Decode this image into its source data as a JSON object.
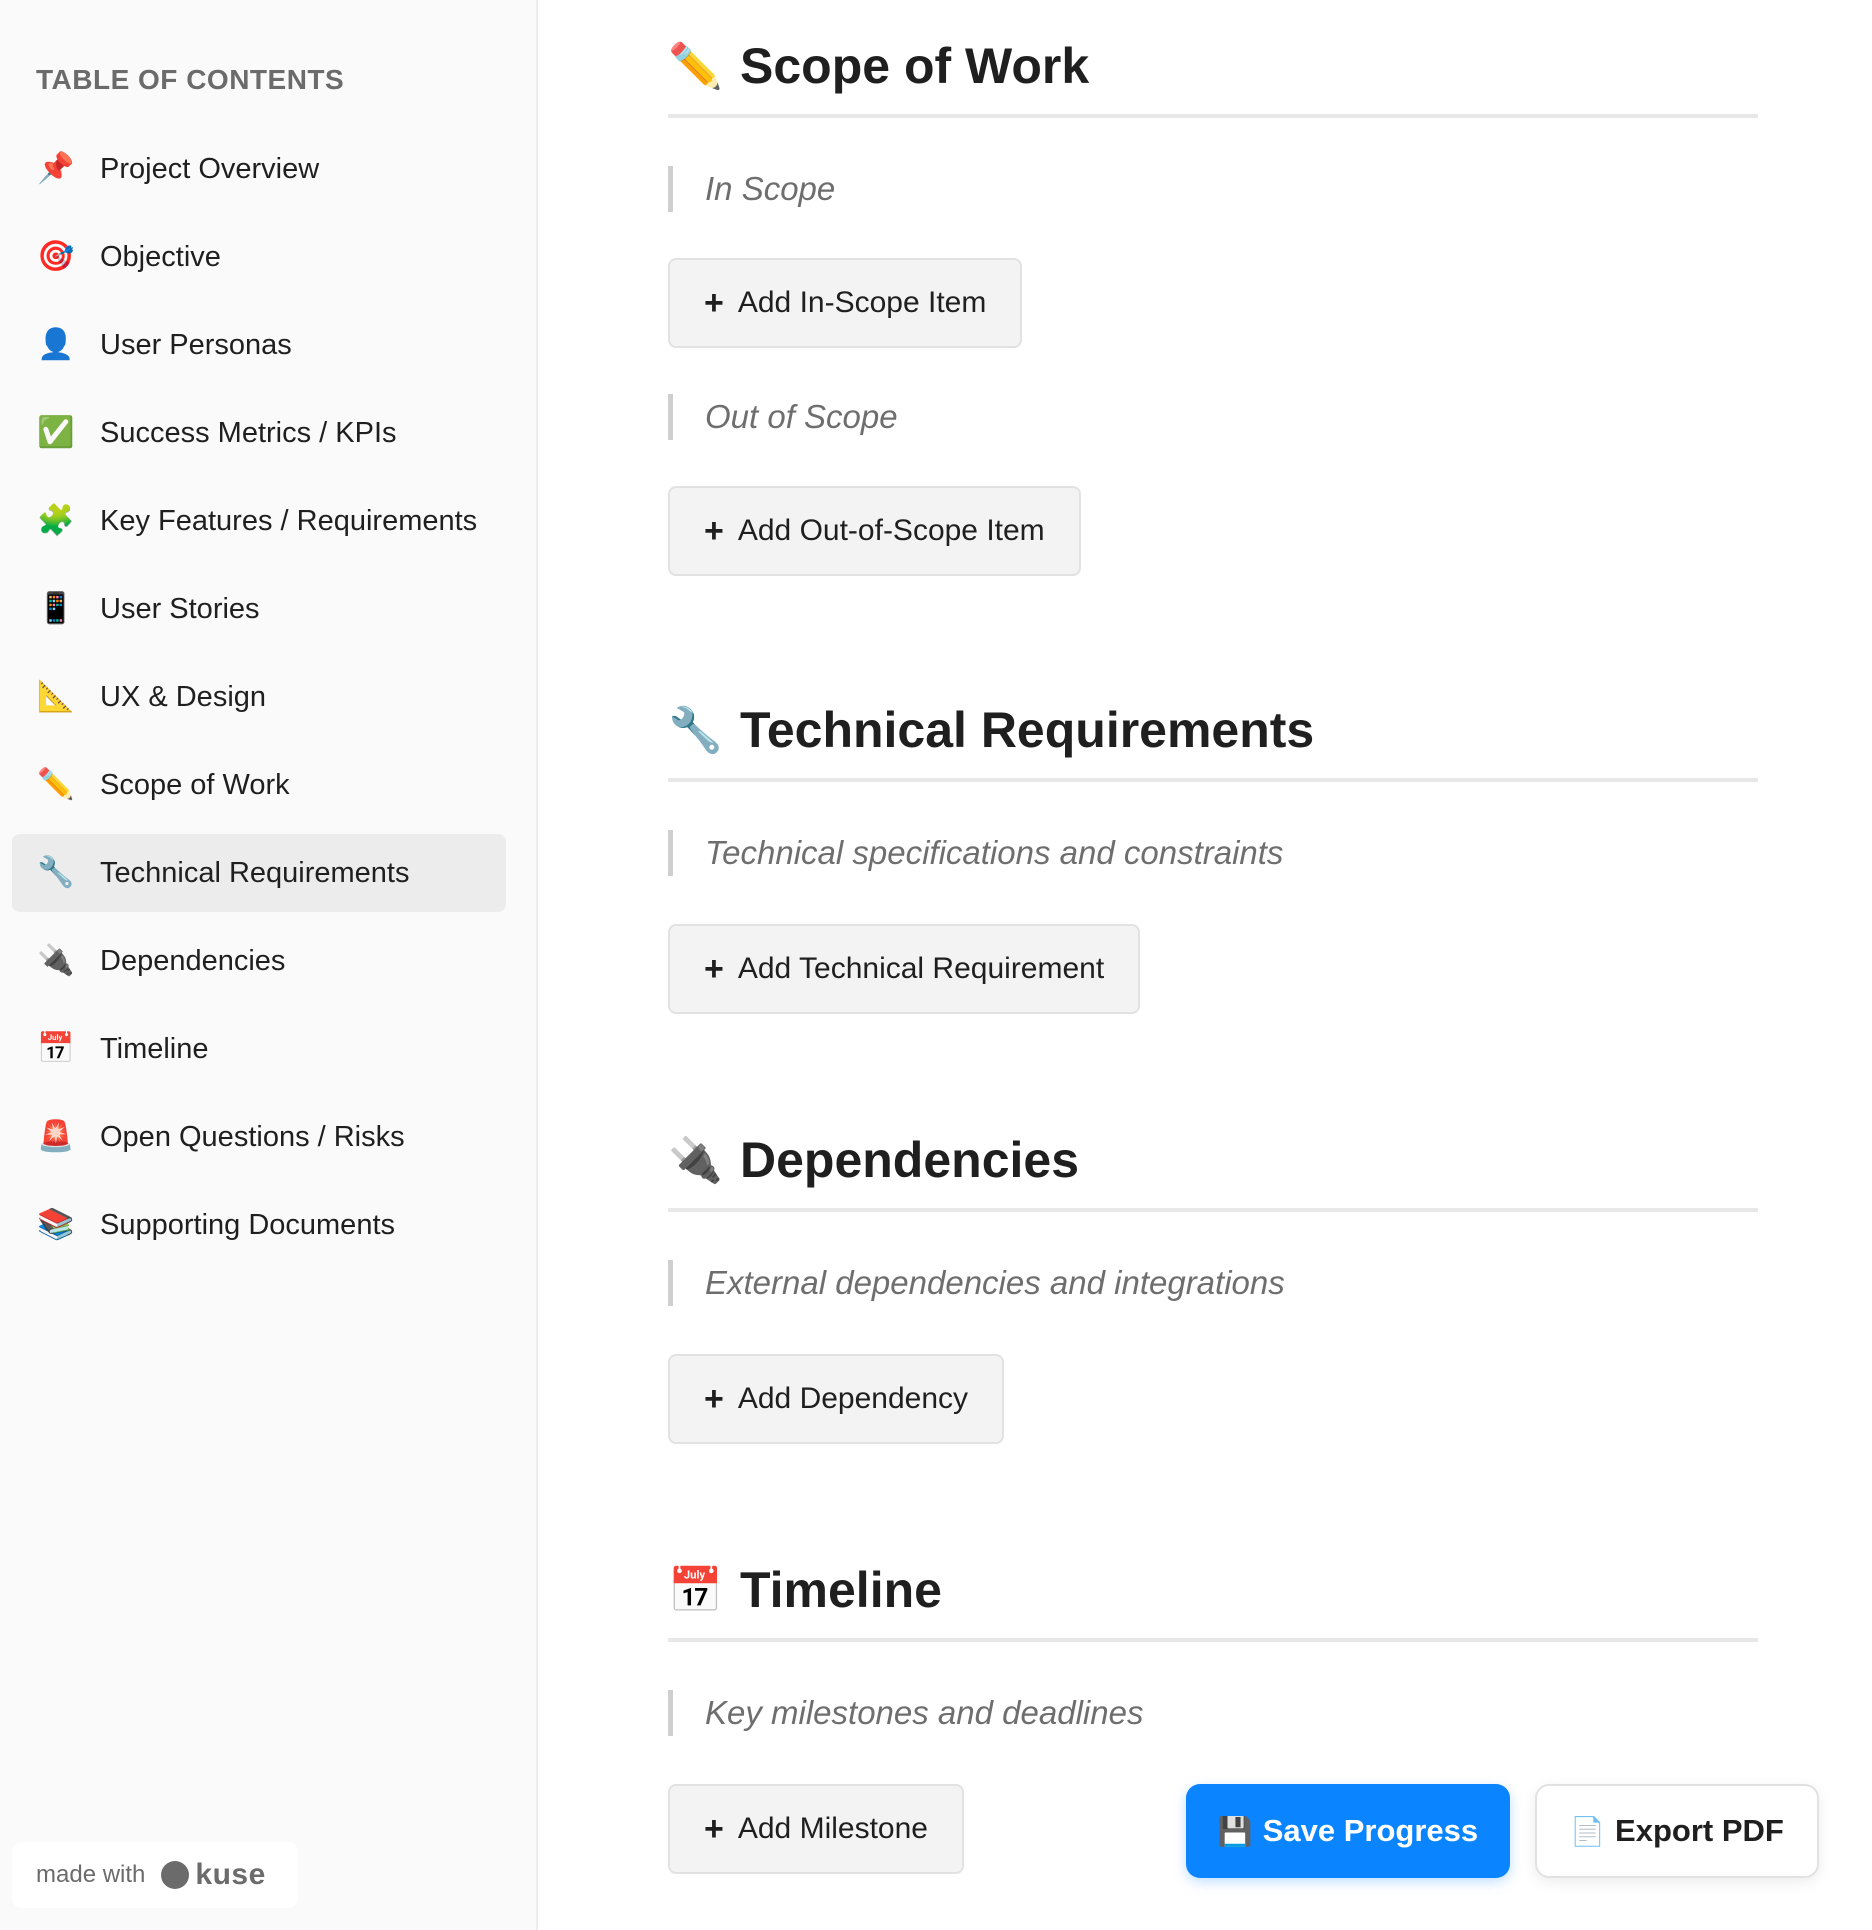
{
  "sidebar": {
    "title": "TABLE OF CONTENTS",
    "items": [
      {
        "icon": "📌",
        "icon_name": "pushpin-icon",
        "label": "Project Overview"
      },
      {
        "icon": "🎯",
        "icon_name": "target-icon",
        "label": "Objective"
      },
      {
        "icon": "👤",
        "icon_name": "user-icon",
        "label": "User Personas"
      },
      {
        "icon": "✅",
        "icon_name": "checkmark-icon",
        "label": "Success Metrics / KPIs"
      },
      {
        "icon": "🧩",
        "icon_name": "puzzle-icon",
        "label": "Key Features / Requirements"
      },
      {
        "icon": "📱",
        "icon_name": "phone-icon",
        "label": "User Stories"
      },
      {
        "icon": "📐",
        "icon_name": "triangle-ruler-icon",
        "label": "UX & Design"
      },
      {
        "icon": "✏️",
        "icon_name": "pencil-icon",
        "label": "Scope of Work"
      },
      {
        "icon": "🔧",
        "icon_name": "wrench-icon",
        "label": "Technical Requirements",
        "active": true
      },
      {
        "icon": "🔌",
        "icon_name": "plug-icon",
        "label": "Dependencies"
      },
      {
        "icon": "📅",
        "icon_name": "calendar-icon",
        "label": "Timeline"
      },
      {
        "icon": "🚨",
        "icon_name": "siren-icon",
        "label": "Open Questions / Risks"
      },
      {
        "icon": "📚",
        "icon_name": "books-icon",
        "label": "Supporting Documents"
      }
    ],
    "made_with": "made with",
    "brand": "kuse"
  },
  "sections": {
    "scope": {
      "icon": "✏️",
      "title": "Scope of Work",
      "in_scope": "In Scope",
      "add_in_scope": "Add In-Scope Item",
      "out_scope": "Out of Scope",
      "add_out_scope": "Add Out-of-Scope Item"
    },
    "technical": {
      "icon": "🔧",
      "title": "Technical Requirements",
      "subtitle": "Technical specifications and constraints",
      "add": "Add Technical Requirement"
    },
    "dependencies": {
      "icon": "🔌",
      "title": "Dependencies",
      "subtitle": "External dependencies and integrations",
      "add": "Add Dependency"
    },
    "timeline": {
      "icon": "📅",
      "title": "Timeline",
      "subtitle": "Key milestones and deadlines",
      "add": "Add Milestone"
    }
  },
  "actions": {
    "save_icon": "💾",
    "save": "Save Progress",
    "export_icon": "📄",
    "export": "Export PDF"
  },
  "plus": "+",
  "colors": {
    "accent": "#0a84ff",
    "sidebar_bg": "#fafafa",
    "active_item": "#ececec"
  }
}
